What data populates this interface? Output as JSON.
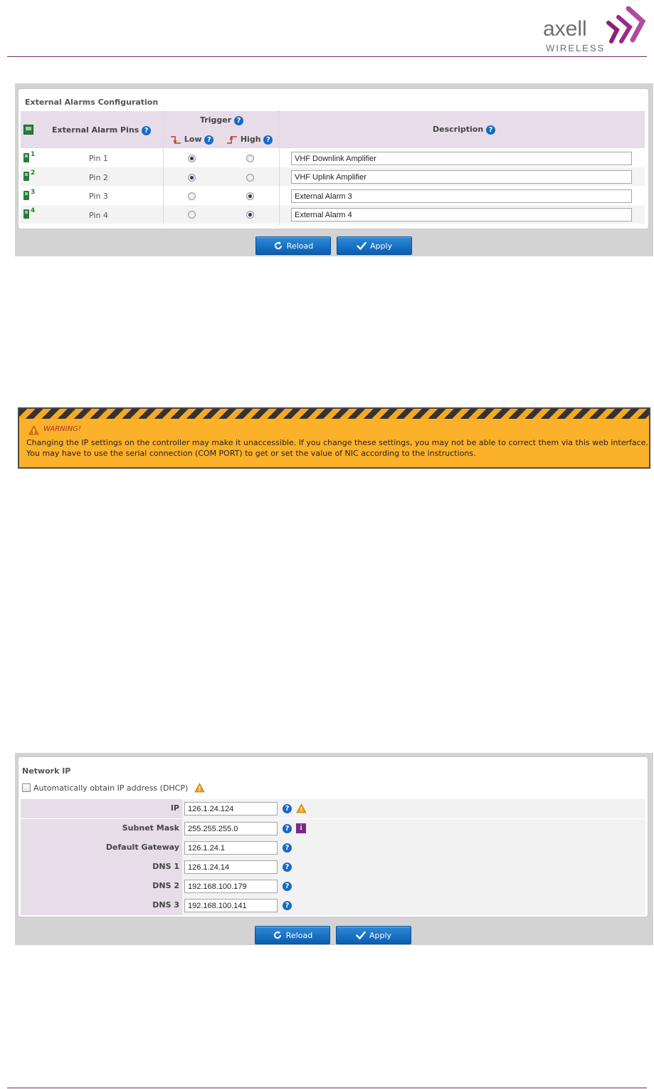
{
  "brand": {
    "name": "axell",
    "sub": "WIRELESS"
  },
  "alarms": {
    "title": "External Alarms Configuration",
    "col_pins": "External Alarm Pins",
    "col_trigger": "Trigger",
    "col_low": "Low",
    "col_high": "High",
    "col_description": "Description",
    "rows": [
      {
        "chip": "1",
        "pin": "Pin 1",
        "trigger": "low",
        "description": "VHF Downlink Amplifier"
      },
      {
        "chip": "2",
        "pin": "Pin 2",
        "trigger": "low",
        "description": "VHF Uplink Amplifier"
      },
      {
        "chip": "3",
        "pin": "Pin 3",
        "trigger": "high",
        "description": "External Alarm 3"
      },
      {
        "chip": "4",
        "pin": "Pin 4",
        "trigger": "high",
        "description": "External Alarm 4"
      }
    ],
    "reload_label": "Reload",
    "apply_label": "Apply"
  },
  "warning": {
    "title": "WARNING!",
    "body": "Changing the IP settings on the controller may make it unaccessible. If you change these settings, you may not be able to correct them via this web interface. You may have to use the serial connection (COM PORT) to get or set the value of NIC according to the instructions."
  },
  "network": {
    "title": "Network IP",
    "dhcp_label": "Automatically obtain IP address (DHCP)",
    "dhcp_checked": false,
    "fields": [
      {
        "label": "IP",
        "value": "126.1.24.124"
      },
      {
        "label": "Subnet Mask",
        "value": "255.255.255.0"
      },
      {
        "label": "Default Gateway",
        "value": "126.1.24.1"
      },
      {
        "label": "DNS 1",
        "value": "126.1.24.14"
      },
      {
        "label": "DNS 2",
        "value": "192.168.100.179"
      },
      {
        "label": "DNS 3",
        "value": "192.168.100.141"
      }
    ],
    "reload_label": "Reload",
    "apply_label": "Apply"
  },
  "colors": {
    "brand_purple": "#7b2a6f",
    "button_blue": "#1769c4",
    "warning_orange": "#fcb12a"
  }
}
